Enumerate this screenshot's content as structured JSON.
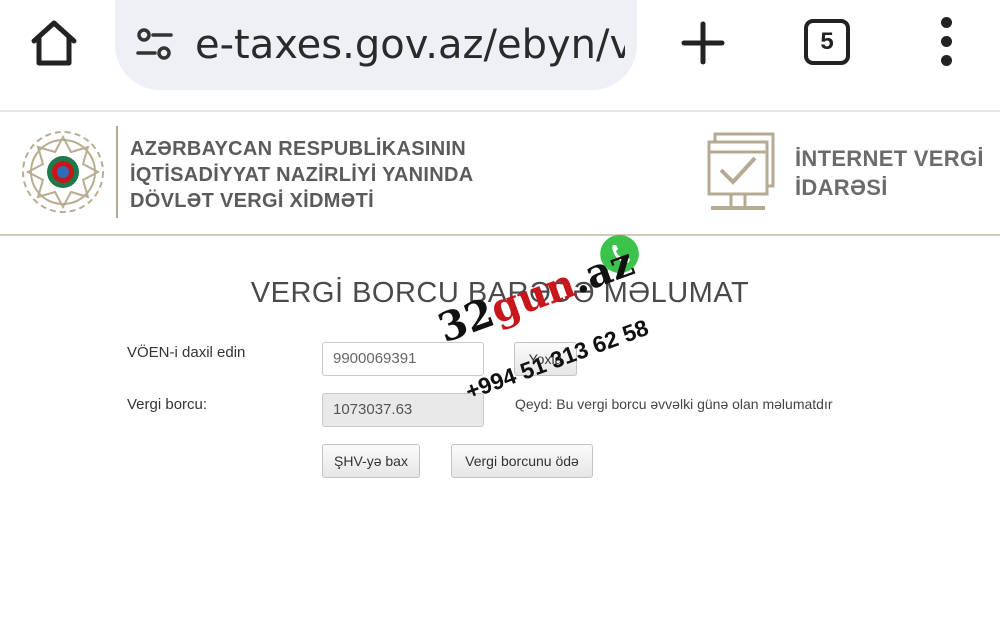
{
  "browser": {
    "url": "e-taxes.gov.az/ebyn/v",
    "tab_count": "5"
  },
  "header": {
    "org_lines": [
      "AZƏRBAYCAN RESPUBLİKASININ",
      "İQTİSADİYYAT NAZİRLİYİ YANINDA",
      "DÖVLƏT VERGİ XİDMƏTİ"
    ],
    "portal_lines": [
      "İNTERNET VERGİ",
      "İDARƏSİ"
    ]
  },
  "page": {
    "title": "VERGİ BORCU BARƏDƏ MƏLUMAT",
    "voen_label": "VÖEN-i daxil edin",
    "voen_value": "9900069391",
    "check_button": "Yoxla",
    "debt_label": "Vergi borcu:",
    "debt_value": "1073037.63",
    "note": "Qeyd: Bu vergi borcu əvvəlki günə olan məlumatdır",
    "shv_button": "ŞHV-yə bax",
    "pay_button": "Vergi borcunu ödə"
  },
  "watermark": {
    "brand_a": "32",
    "brand_b": "gun",
    "brand_c": ".az",
    "phone": "+994 51 313 62 58"
  },
  "colors": {
    "accent_gold": "#b5aa93",
    "watermark_red": "#c8161d",
    "whatsapp_green": "#3cc34c"
  },
  "icons": [
    "home-icon",
    "tune-icon",
    "plus-icon",
    "tabs-icon",
    "more-vert-icon",
    "emblem-icon",
    "monitor-check-icon",
    "whatsapp-icon"
  ]
}
